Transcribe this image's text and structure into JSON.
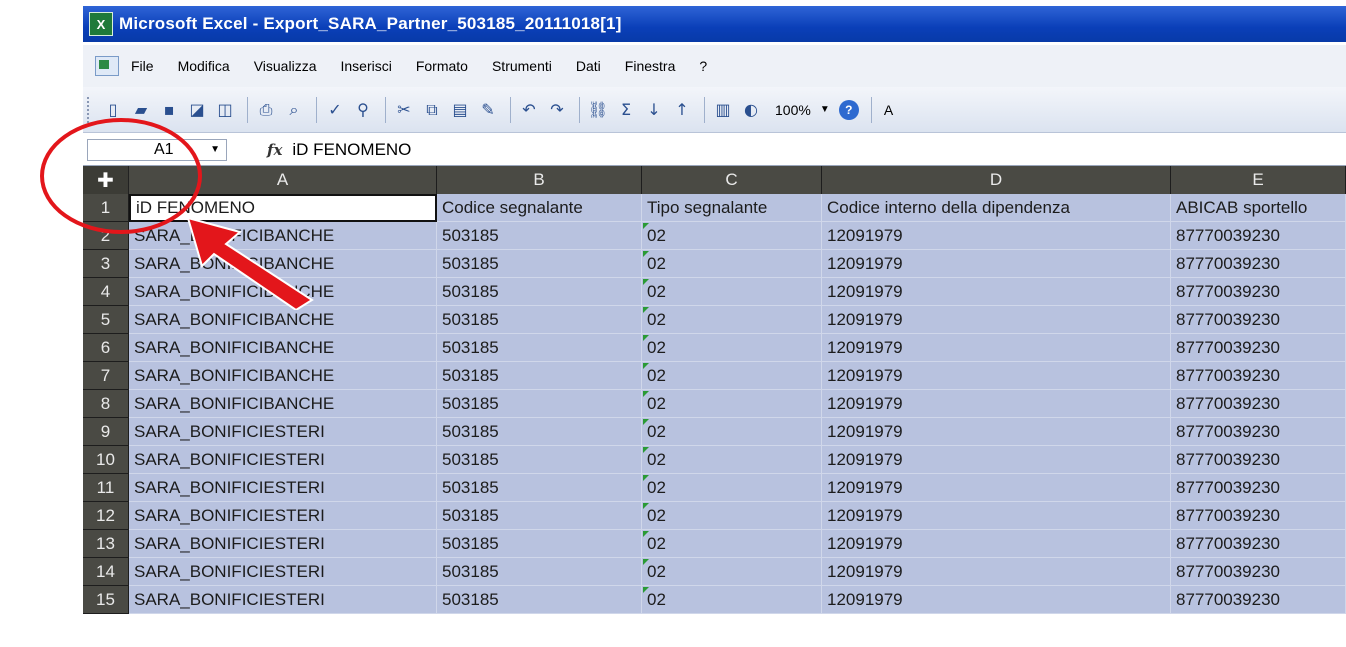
{
  "window": {
    "icon": "excel-icon",
    "title": "Microsoft Excel - Export_SARA_Partner_503185_20111018[1]"
  },
  "menu": {
    "items": [
      "File",
      "Modifica",
      "Visualizza",
      "Inserisci",
      "Formato",
      "Strumenti",
      "Dati",
      "Finestra",
      "?"
    ]
  },
  "toolbar": {
    "zoom": "100%",
    "more": "A"
  },
  "formula_bar": {
    "cell_ref": "A1",
    "fx_label": "fx",
    "value": "iD FENOMENO"
  },
  "sheet": {
    "columns": [
      "A",
      "B",
      "C",
      "D",
      "E"
    ],
    "header_row": [
      "iD FENOMENO",
      "Codice segnalante",
      "Tipo segnalante",
      "Codice interno della dipendenza",
      "ABICAB sportello"
    ],
    "rows": [
      {
        "n": "1"
      },
      {
        "n": "2",
        "a": "SARA_BONIFICIBANCHE",
        "b": "503185",
        "c": "02",
        "d": "12091979",
        "e": "87770039230"
      },
      {
        "n": "3",
        "a": "SARA_BONIFICIBANCHE",
        "b": "503185",
        "c": "02",
        "d": "12091979",
        "e": "87770039230"
      },
      {
        "n": "4",
        "a": "SARA_BONIFICIBANCHE",
        "b": "503185",
        "c": "02",
        "d": "12091979",
        "e": "87770039230"
      },
      {
        "n": "5",
        "a": "SARA_BONIFICIBANCHE",
        "b": "503185",
        "c": "02",
        "d": "12091979",
        "e": "87770039230"
      },
      {
        "n": "6",
        "a": "SARA_BONIFICIBANCHE",
        "b": "503185",
        "c": "02",
        "d": "12091979",
        "e": "87770039230"
      },
      {
        "n": "7",
        "a": "SARA_BONIFICIBANCHE",
        "b": "503185",
        "c": "02",
        "d": "12091979",
        "e": "87770039230"
      },
      {
        "n": "8",
        "a": "SARA_BONIFICIBANCHE",
        "b": "503185",
        "c": "02",
        "d": "12091979",
        "e": "87770039230"
      },
      {
        "n": "9",
        "a": "SARA_BONIFICIESTERI",
        "b": "503185",
        "c": "02",
        "d": "12091979",
        "e": "87770039230"
      },
      {
        "n": "10",
        "a": "SARA_BONIFICIESTERI",
        "b": "503185",
        "c": "02",
        "d": "12091979",
        "e": "87770039230"
      },
      {
        "n": "11",
        "a": "SARA_BONIFICIESTERI",
        "b": "503185",
        "c": "02",
        "d": "12091979",
        "e": "87770039230"
      },
      {
        "n": "12",
        "a": "SARA_BONIFICIESTERI",
        "b": "503185",
        "c": "02",
        "d": "12091979",
        "e": "87770039230"
      },
      {
        "n": "13",
        "a": "SARA_BONIFICIESTERI",
        "b": "503185",
        "c": "02",
        "d": "12091979",
        "e": "87770039230"
      },
      {
        "n": "14",
        "a": "SARA_BONIFICIESTERI",
        "b": "503185",
        "c": "02",
        "d": "12091979",
        "e": "87770039230"
      },
      {
        "n": "15",
        "a": "SARA_BONIFICIESTERI",
        "b": "503185",
        "c": "02",
        "d": "12091979",
        "e": "87770039230"
      }
    ]
  },
  "annotations": {
    "circle_color": "#e3161b",
    "arrow_color": "#e3161b"
  },
  "colors": {
    "title_bar": "#0a3fb8",
    "selection": "#b8c2df",
    "headers": "#4a4a44"
  }
}
